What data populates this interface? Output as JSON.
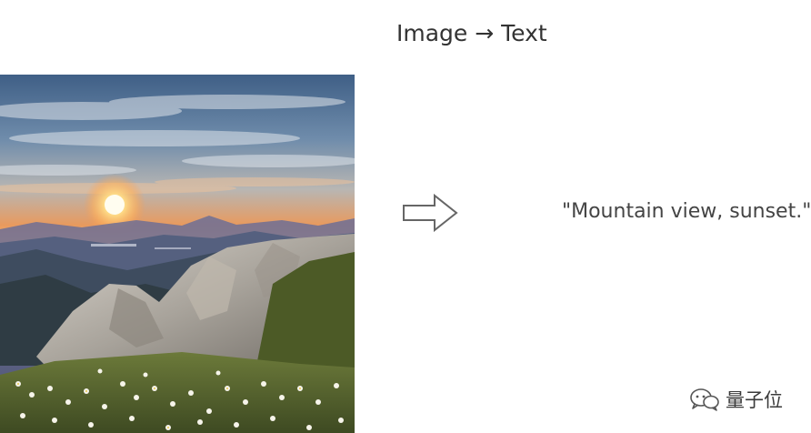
{
  "title": "Image → Text",
  "caption": "\"Mountain view, sunset.\"",
  "watermark": {
    "text": "量子位",
    "icon": "wechat-chat-bubbles-icon"
  },
  "photo": {
    "subject": "mountain-sunset-photo"
  },
  "arrow": {
    "icon": "right-outline-arrow-icon"
  },
  "colors": {
    "title": "#333333",
    "caption": "#444444",
    "arrow_stroke": "#666666",
    "background": "#ffffff"
  }
}
